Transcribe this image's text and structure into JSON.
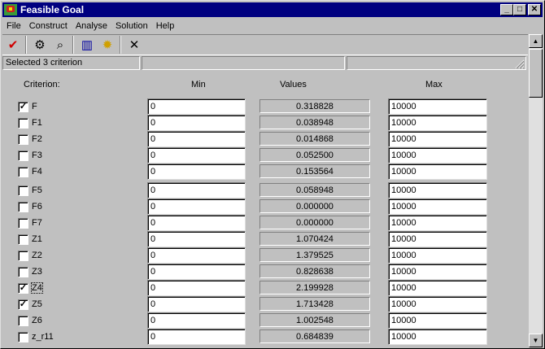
{
  "window": {
    "title": "Feasible Goal"
  },
  "menu": [
    "File",
    "Construct",
    "Analyse",
    "Solution",
    "Help"
  ],
  "toolbar": {
    "tools": [
      {
        "name": "checkmark-icon",
        "glyph": "✔",
        "color": "#d00000"
      },
      {
        "name": "gear-icon",
        "glyph": "⚙",
        "color": "#000000"
      },
      {
        "name": "binoculars-icon",
        "glyph": "⌕",
        "color": "#000000"
      },
      {
        "name": "chart-icon",
        "glyph": "▥",
        "color": "#0000a0"
      },
      {
        "name": "sun-icon",
        "glyph": "✹",
        "color": "#d0a000"
      },
      {
        "name": "close-x-icon",
        "glyph": "✕",
        "color": "#000000"
      }
    ]
  },
  "status": {
    "text": "Selected 3 criterion"
  },
  "headers": {
    "criterion": "Criterion:",
    "min": "Min",
    "values": "Values",
    "max": "Max"
  },
  "rows": [
    {
      "label": "F",
      "checked": true,
      "min": "0",
      "value": "0.318828",
      "max": "10000"
    },
    {
      "label": "F1",
      "checked": false,
      "min": "0",
      "value": "0.038948",
      "max": "10000"
    },
    {
      "label": "F2",
      "checked": false,
      "min": "0",
      "value": "0.014868",
      "max": "10000"
    },
    {
      "label": "F3",
      "checked": false,
      "min": "0",
      "value": "0.052500",
      "max": "10000"
    },
    {
      "label": "F4",
      "checked": false,
      "min": "0",
      "value": "0.153564",
      "max": "10000"
    },
    {
      "label": "F5",
      "checked": false,
      "min": "0",
      "value": "0.058948",
      "max": "10000"
    },
    {
      "label": "F6",
      "checked": false,
      "min": "0",
      "value": "0.000000",
      "max": "10000"
    },
    {
      "label": "F7",
      "checked": false,
      "min": "0",
      "value": "0.000000",
      "max": "10000"
    },
    {
      "label": "Z1",
      "checked": false,
      "min": "0",
      "value": "1.070424",
      "max": "10000"
    },
    {
      "label": "Z2",
      "checked": false,
      "min": "0",
      "value": "1.379525",
      "max": "10000"
    },
    {
      "label": "Z3",
      "checked": false,
      "min": "0",
      "value": "0.828638",
      "max": "10000"
    },
    {
      "label": "Z4",
      "checked": true,
      "min": "0",
      "value": "2.199928",
      "max": "10000",
      "focus": true
    },
    {
      "label": "Z5",
      "checked": true,
      "min": "0",
      "value": "1.713428",
      "max": "10000"
    },
    {
      "label": "Z6",
      "checked": false,
      "min": "0",
      "value": "1.002548",
      "max": "10000"
    },
    {
      "label": "z_r11",
      "checked": false,
      "min": "0",
      "value": "0.684839",
      "max": "10000"
    }
  ]
}
